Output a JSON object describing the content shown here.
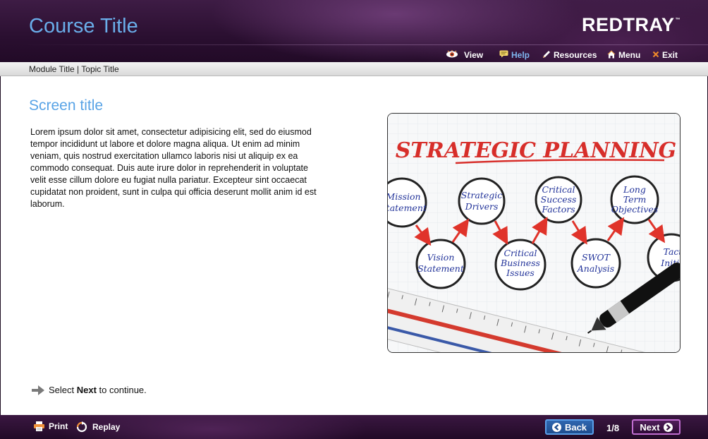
{
  "header": {
    "course_title": "Course Title",
    "brand": "REDTRAY",
    "brand_tm": "™",
    "nav": {
      "view": "View",
      "help": "Help",
      "resources": "Resources",
      "menu": "Menu",
      "exit": "Exit"
    }
  },
  "breadcrumb": "Module Title | Topic Title",
  "main": {
    "screen_title": "Screen title",
    "body": "Lorem ipsum dolor sit amet, consectetur adipisicing elit, sed do eiusmod tempor incididunt ut labore et dolore magna aliqua. Ut enim ad minim veniam, quis nostrud exercitation ullamco laboris nisi ut aliquip ex ea commodo consequat. Duis aute irure dolor in reprehenderit in voluptate velit esse cillum dolore eu fugiat nulla pariatur. Excepteur sint occaecat cupidatat non proident, sunt in culpa qui officia deserunt mollit anim id est laborum.",
    "image": {
      "heading": "STRATEGIC PLANNING",
      "top_circles": [
        "Mission Statement",
        "Strategic Drivers",
        "Critical Success Factors",
        "Long Term Objectives"
      ],
      "bottom_circles": [
        "Vision Statement",
        "Critical Business Issues",
        "SWOT Analysis",
        "Tactical Initia"
      ]
    },
    "instruction_prefix": "Select ",
    "instruction_bold": "Next",
    "instruction_suffix": " to continue."
  },
  "footer": {
    "print": "Print",
    "replay": "Replay",
    "back": "Back",
    "page": "1/8",
    "next": "Next"
  },
  "colors": {
    "title_blue": "#6aaeea",
    "header_purple": "#2a0f30",
    "help_blue": "#7fb6ef",
    "back_blue": "#2f67b0",
    "next_purple": "#4e1d58"
  }
}
